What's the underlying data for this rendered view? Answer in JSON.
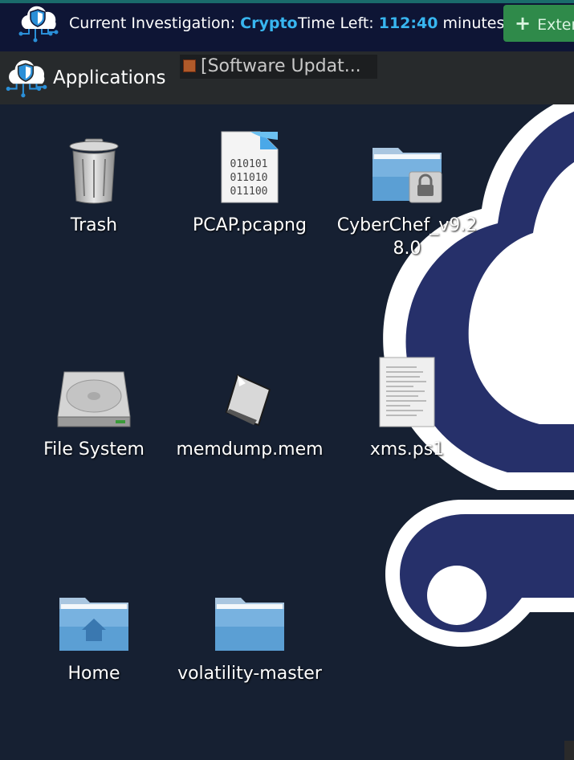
{
  "topbar": {
    "investigation_label": "Current Investigation:",
    "investigation_name": "Crypto",
    "time_label": "Time Left:",
    "time_value": "112:40",
    "time_unit": "minutes",
    "extend_button": "Exter"
  },
  "panel": {
    "applications": "Applications",
    "task_title": "[Software Updat..."
  },
  "desktop": {
    "icons": [
      {
        "label": "Trash"
      },
      {
        "label": "PCAP.pcapng",
        "binary_lines": [
          "010101",
          "011010",
          "011100"
        ]
      },
      {
        "label": "CyberChef_v9.28.0"
      },
      {
        "label": "File System"
      },
      {
        "label": "memdump.mem"
      },
      {
        "label": "xms.ps1"
      },
      {
        "label": "Home"
      },
      {
        "label": "volatility-master"
      }
    ]
  },
  "colors": {
    "accent": "#38b6f0",
    "topbar_bg": "#0e1535",
    "desktop_bg": "#162032",
    "wallpaper_navy": "#26306a",
    "button_green": "#2f8a4a"
  }
}
